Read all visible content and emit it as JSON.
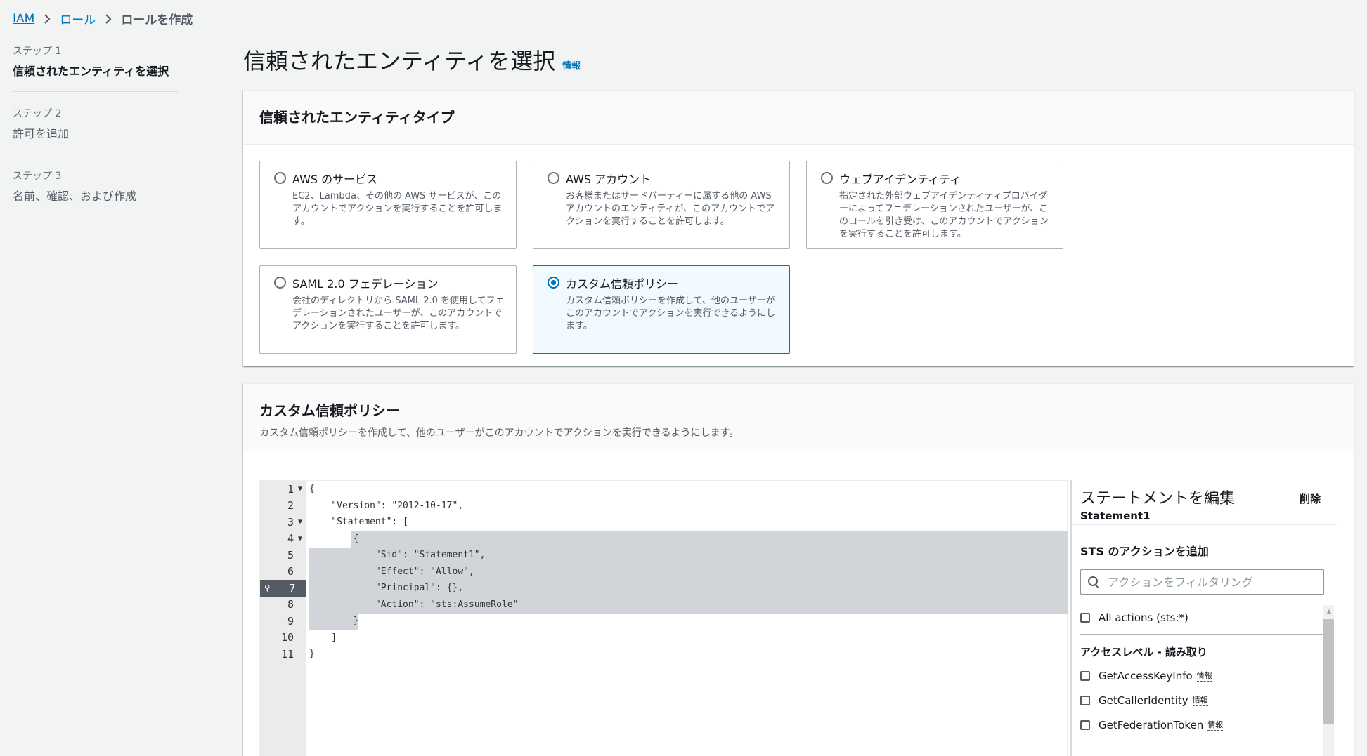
{
  "breadcrumb": {
    "items": [
      "IAM",
      "ロール"
    ],
    "current": "ロールを作成"
  },
  "wizard": {
    "steps": [
      {
        "number": "ステップ 1",
        "title": "信頼されたエンティティを選択"
      },
      {
        "number": "ステップ 2",
        "title": "許可を追加"
      },
      {
        "number": "ステップ 3",
        "title": "名前、確認、および作成"
      }
    ]
  },
  "page": {
    "title": "信頼されたエンティティを選択",
    "info": "情報"
  },
  "entity_type": {
    "title": "信頼されたエンティティタイプ",
    "tiles": [
      {
        "title": "AWS のサービス",
        "desc": "EC2、Lambda、その他の AWS サービスが、このアカウントでアクションを実行することを許可します。",
        "selected": false
      },
      {
        "title": "AWS アカウント",
        "desc": "お客様またはサードパーティーに属する他の AWS アカウントのエンティティが、このアカウントでアクションを実行することを許可します。",
        "selected": false
      },
      {
        "title": "ウェブアイデンティティ",
        "desc": "指定された外部ウェブアイデンティティプロバイダーによってフェデレーションされたユーザーが、このロールを引き受け、このアカウントでアクションを実行することを許可します。",
        "selected": false
      },
      {
        "title": "SAML 2.0 フェデレーション",
        "desc": "会社のディレクトリから SAML 2.0 を使用してフェデレーションされたユーザーが、このアカウントでアクションを実行することを許可します。",
        "selected": false
      },
      {
        "title": "カスタム信頼ポリシー",
        "desc": "カスタム信頼ポリシーを作成して、他のユーザーがこのアカウントでアクションを実行できるようにします。",
        "selected": true
      }
    ]
  },
  "custom_policy": {
    "title": "カスタム信頼ポリシー",
    "desc": "カスタム信頼ポリシーを作成して、他のユーザーがこのアカウントでアクションを実行できるようにします。"
  },
  "editor": {
    "lines": [
      {
        "num": "1",
        "fold": true,
        "text": "{"
      },
      {
        "num": "2",
        "fold": false,
        "text": "    \"Version\": \"2012-10-17\","
      },
      {
        "num": "3",
        "fold": true,
        "text": "    \"Statement\": ["
      },
      {
        "num": "4",
        "fold": true,
        "text": "        {"
      },
      {
        "num": "5",
        "fold": false,
        "text": "            \"Sid\": \"Statement1\","
      },
      {
        "num": "6",
        "fold": false,
        "text": "            \"Effect\": \"Allow\","
      },
      {
        "num": "7",
        "fold": false,
        "text": "            \"Principal\": {},"
      },
      {
        "num": "8",
        "fold": false,
        "text": "            \"Action\": \"sts:AssumeRole\""
      },
      {
        "num": "9",
        "fold": false,
        "text": "        }"
      },
      {
        "num": "10",
        "fold": false,
        "text": "    ]"
      },
      {
        "num": "11",
        "fold": false,
        "text": "}"
      }
    ],
    "bulb_line": "7"
  },
  "statement_panel": {
    "title": "ステートメントを編集",
    "statement": "Statement1",
    "delete": "削除",
    "section_title": "STS のアクションを追加",
    "filter_placeholder": "アクションをフィルタリング",
    "all_actions": "All actions (sts:*)",
    "access_level": "アクセスレベル - 読み取り",
    "actions": [
      "GetAccessKeyInfo",
      "GetCallerIdentity",
      "GetFederationToken"
    ],
    "info": "情報"
  }
}
